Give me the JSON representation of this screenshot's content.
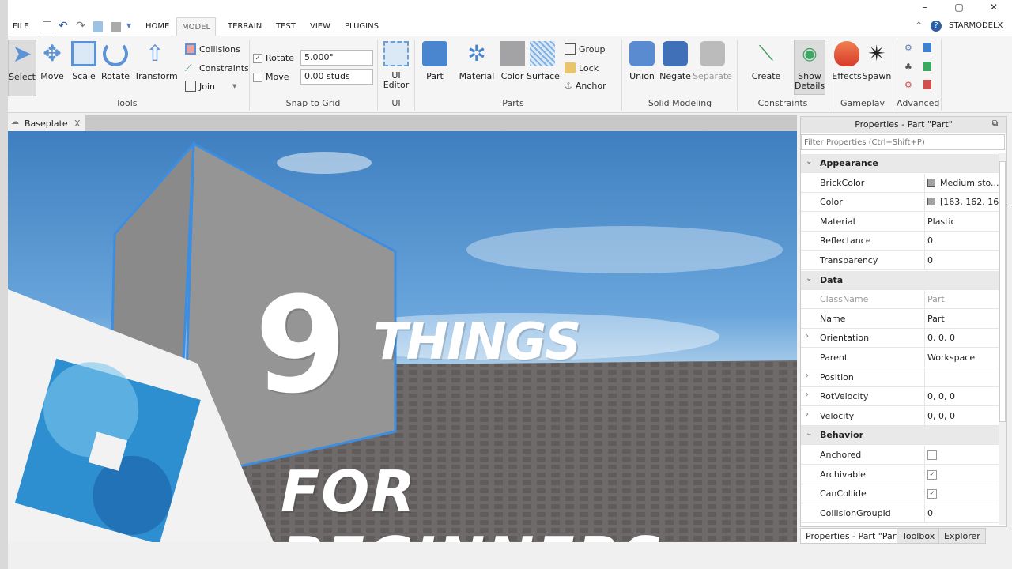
{
  "window": {
    "minimize": "–",
    "maximize": "▢",
    "close": "✕",
    "user": "STARMODELX"
  },
  "menu": {
    "file": "FILE",
    "tabs": [
      "HOME",
      "MODEL",
      "TERRAIN",
      "TEST",
      "VIEW",
      "PLUGINS"
    ],
    "active": "MODEL"
  },
  "ribbon": {
    "tools": {
      "items": [
        "Select",
        "Move",
        "Scale",
        "Rotate",
        "Transform"
      ],
      "group": "Tools"
    },
    "toggles": {
      "collisions": "Collisions",
      "constraints": "Constraints",
      "join": "Join"
    },
    "snap": {
      "rotate_label": "Rotate",
      "rotate_value": "5.000°",
      "rotate_checked": true,
      "move_label": "Move",
      "move_value": "0.00 studs",
      "move_checked": false,
      "group": "Snap to Grid"
    },
    "ui": {
      "editor": "UI Editor",
      "group": "UI"
    },
    "parts": {
      "part": "Part",
      "material": "Material",
      "color": "Color",
      "surface": "Surface",
      "group_btn": "Group",
      "lock": "Lock",
      "anchor": "Anchor",
      "group": "Parts"
    },
    "solid": {
      "union": "Union",
      "negate": "Negate",
      "separate": "Separate",
      "group": "Solid Modeling"
    },
    "constraints": {
      "create": "Create",
      "show_details": "Show Details",
      "group": "Constraints"
    },
    "gameplay": {
      "effects": "Effects",
      "spawn": "Spawn",
      "group": "Gameplay"
    },
    "advanced": {
      "group": "Advanced"
    }
  },
  "document": {
    "tab": "Baseplate",
    "close": "X"
  },
  "overlay": {
    "number": "9",
    "line1": "THINGS",
    "line2": "FOR BEGINNERS"
  },
  "properties": {
    "title": "Properties - Part \"Part\"",
    "filter_placeholder": "Filter Properties (Ctrl+Shift+P)",
    "rows": [
      {
        "cat": true,
        "name": "Appearance"
      },
      {
        "name": "BrickColor",
        "value": "Medium sto...",
        "swatch": "#a3a2a5"
      },
      {
        "name": "Color",
        "value": "[163, 162, 16...",
        "swatch": "#a3a2a5"
      },
      {
        "name": "Material",
        "value": "Plastic"
      },
      {
        "name": "Reflectance",
        "value": "0"
      },
      {
        "name": "Transparency",
        "value": "0"
      },
      {
        "cat": true,
        "name": "Data"
      },
      {
        "name": "ClassName",
        "value": "Part",
        "muted": true
      },
      {
        "name": "Name",
        "value": "Part"
      },
      {
        "name": "Orientation",
        "value": "0, 0, 0",
        "expand": true
      },
      {
        "name": "Parent",
        "value": "Workspace"
      },
      {
        "name": "Position",
        "value": "",
        "expand": true
      },
      {
        "name": "RotVelocity",
        "value": "0, 0, 0",
        "expand": true
      },
      {
        "name": "Velocity",
        "value": "0, 0, 0",
        "expand": true
      },
      {
        "cat": true,
        "name": "Behavior"
      },
      {
        "name": "Anchored",
        "check": false
      },
      {
        "name": "Archivable",
        "check": true
      },
      {
        "name": "CanCollide",
        "check": true
      },
      {
        "name": "CollisionGroupId",
        "value": "0"
      }
    ]
  },
  "bottom_tabs": [
    "Properties - Part \"Part\"",
    "Toolbox",
    "Explorer"
  ]
}
